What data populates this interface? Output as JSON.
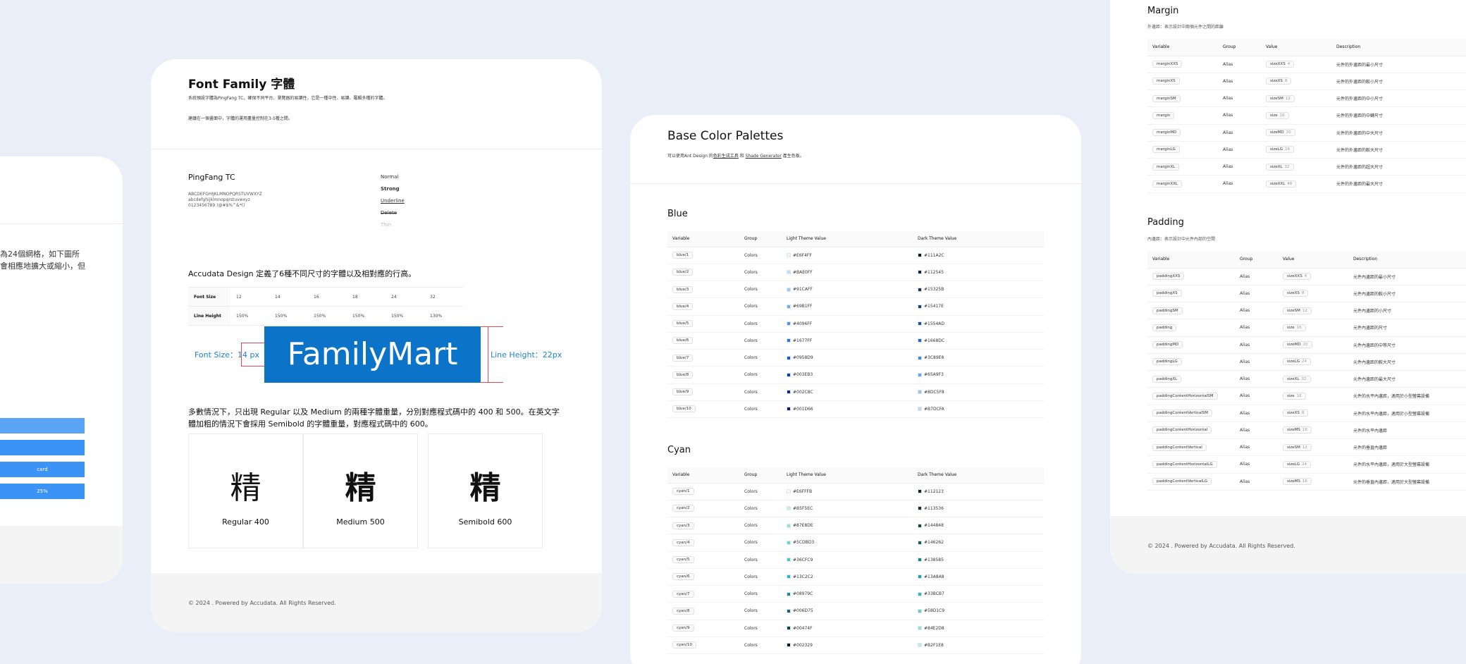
{
  "card1": {
    "text_lines": [
      "為24個網格，如下圖所",
      "會相應地擴大或縮小，但"
    ],
    "bars": [
      "",
      "",
      "card",
      "25%"
    ]
  },
  "fontfamily": {
    "title": "Font Family 字體",
    "desc1": "系統預設字體為PingFang TC，確保不同平台、瀏覽器的易讀性，它是一種中性、易讀、羅輯多種的字體。",
    "desc2": "建議在一個畫面中，字體的運用盡量控制在3-5種之間。",
    "font_name": "PingFang TC",
    "alphabet": [
      "ABCDEFGHIJKLMNOPQRSTUVWXYZ",
      "abcdefghijklmnopqrstuvwxyz",
      "0123456789 !@#$%^&*()"
    ],
    "styles": [
      "Normal",
      "Strong",
      "Underline",
      "Delete",
      "Thin"
    ],
    "sizes_heading": "Accudata Design 定義了6種不同尺寸的字體以及相對應的行高。",
    "size_row_label": "Font Size",
    "sizes": [
      "12",
      "14",
      "16",
      "18",
      "24",
      "32"
    ],
    "lh_row_label": "Line Height",
    "line_heights": [
      "150%",
      "150%",
      "150%",
      "150%",
      "150%",
      "130%"
    ],
    "demo_word": "FamilyMart",
    "demo_font_size_label": "Font Size：14 px",
    "demo_line_height_label": "Line Height：22px",
    "weights_text": "多數情況下，只出現 Regular 以及 Medium 的兩種字體重量，分別對應程式碼中的 400 和 500。在英文字體加粗的情況下會採用 Semibold 的字體重量，對應程式碼中的 600。",
    "weight_glyph": "精",
    "weights": [
      "Regular 400",
      "Medium 500",
      "Semibold 600"
    ],
    "footer": "© 2024 . Powered by Accudata. All Rights Reserved."
  },
  "palettes": {
    "title": "Base Color Palettes",
    "desc_prefix": "可以使用Ant Design 的",
    "link1": "色彩生成工具",
    "desc_mid": " 和 ",
    "link2": "Shade Generator",
    "desc_suffix": " 產生色板。",
    "headers": [
      "Variable",
      "Group",
      "Light Theme Value",
      "Dark Theme Value"
    ],
    "blue_title": "Blue",
    "blue": [
      {
        "var": "blue/1",
        "group": "Colors",
        "light": "#E6F4FF",
        "dark": "#111A2C"
      },
      {
        "var": "blue/2",
        "group": "Colors",
        "light": "#BAE0FF",
        "dark": "#112545"
      },
      {
        "var": "blue/3",
        "group": "Colors",
        "light": "#91CAFF",
        "dark": "#15325B"
      },
      {
        "var": "blue/4",
        "group": "Colors",
        "light": "#69B1FF",
        "dark": "#15417E"
      },
      {
        "var": "blue/5",
        "group": "Colors",
        "light": "#4096FF",
        "dark": "#1554AD"
      },
      {
        "var": "blue/6",
        "group": "Colors",
        "light": "#1677FF",
        "dark": "#1668DC"
      },
      {
        "var": "blue/7",
        "group": "Colors",
        "light": "#0958D9",
        "dark": "#3C89E8"
      },
      {
        "var": "blue/8",
        "group": "Colors",
        "light": "#003EB3",
        "dark": "#65A9F3"
      },
      {
        "var": "blue/9",
        "group": "Colors",
        "light": "#002C8C",
        "dark": "#8DC5F8"
      },
      {
        "var": "blue/10",
        "group": "Colors",
        "light": "#001D66",
        "dark": "#B7DCFA"
      }
    ],
    "cyan_title": "Cyan",
    "cyan": [
      {
        "var": "cyan/1",
        "group": "Colors",
        "light": "#E6FFFB",
        "dark": "#112123"
      },
      {
        "var": "cyan/2",
        "group": "Colors",
        "light": "#B5F5EC",
        "dark": "#113536"
      },
      {
        "var": "cyan/3",
        "group": "Colors",
        "light": "#87E8DE",
        "dark": "#144848"
      },
      {
        "var": "cyan/4",
        "group": "Colors",
        "light": "#5CDBD3",
        "dark": "#146262"
      },
      {
        "var": "cyan/5",
        "group": "Colors",
        "light": "#36CFC9",
        "dark": "#138585"
      },
      {
        "var": "cyan/6",
        "group": "Colors",
        "light": "#13C2C2",
        "dark": "#13A8A8"
      },
      {
        "var": "cyan/7",
        "group": "Colors",
        "light": "#08979C",
        "dark": "#33BCB7"
      },
      {
        "var": "cyan/8",
        "group": "Colors",
        "light": "#006D75",
        "dark": "#58D1C9"
      },
      {
        "var": "cyan/9",
        "group": "Colors",
        "light": "#00474F",
        "dark": "#84E2D8"
      },
      {
        "var": "cyan/10",
        "group": "Colors",
        "light": "#002329",
        "dark": "#B2F1E8"
      }
    ]
  },
  "spacing": {
    "margin_title": "Margin",
    "margin_desc": "外邊距：表示設計中兩個元件之間的距離",
    "headers": [
      "Variable",
      "Group",
      "Value",
      "Description"
    ],
    "margin": [
      {
        "var": "marginXXS",
        "group": "Alias",
        "val": "sizeXXS",
        "num": "4",
        "desc": "元件的外邊距的最小尺寸"
      },
      {
        "var": "marginXS",
        "group": "Alias",
        "val": "sizeXS",
        "num": "8",
        "desc": "元件的外邊距的較小尺寸"
      },
      {
        "var": "marginSM",
        "group": "Alias",
        "val": "sizeSM",
        "num": "12",
        "desc": "元件的外邊距的中小尺寸"
      },
      {
        "var": "margin",
        "group": "Alias",
        "val": "size",
        "num": "16",
        "desc": "元件的外邊距的中轉尺寸"
      },
      {
        "var": "marginMD",
        "group": "Alias",
        "val": "sizeMD",
        "num": "20",
        "desc": "元件的外邊距的中大尺寸"
      },
      {
        "var": "marginLG",
        "group": "Alias",
        "val": "sizeLG",
        "num": "24",
        "desc": "元件的外邊距的較大尺寸"
      },
      {
        "var": "marginXL",
        "group": "Alias",
        "val": "sizeXL",
        "num": "32",
        "desc": "元件的外邊距的超大尺寸"
      },
      {
        "var": "marginXXL",
        "group": "Alias",
        "val": "sizeXXL",
        "num": "48",
        "desc": "元件的外邊距的最大尺寸"
      }
    ],
    "padding_title": "Padding",
    "padding_desc": "內邊距：表示設計中元件內部的空間",
    "padding": [
      {
        "var": "paddingXXS",
        "group": "Alias",
        "val": "sizeXXS",
        "num": "4",
        "desc": "元件內邊距的最小尺寸"
      },
      {
        "var": "paddingXS",
        "group": "Alias",
        "val": "sizeXS",
        "num": "8",
        "desc": "元件內邊距的較小尺寸"
      },
      {
        "var": "paddingSM",
        "group": "Alias",
        "val": "sizeSM",
        "num": "12",
        "desc": "元件內邊距的小尺寸"
      },
      {
        "var": "padding",
        "group": "Alias",
        "val": "size",
        "num": "16",
        "desc": "元件內邊距的尺寸"
      },
      {
        "var": "paddingMD",
        "group": "Alias",
        "val": "sizeMD",
        "num": "20",
        "desc": "元件內邊距的中等尺寸"
      },
      {
        "var": "paddingLG",
        "group": "Alias",
        "val": "sizeLG",
        "num": "24",
        "desc": "元件內邊距的較大尺寸"
      },
      {
        "var": "paddingXL",
        "group": "Alias",
        "val": "sizeXL",
        "num": "32",
        "desc": "元件內邊距的最大尺寸"
      },
      {
        "var": "paddingContentHorizontalSM",
        "group": "Alias",
        "val": "size",
        "num": "16",
        "desc": "元件的水平內邊距，適用於小型螢幕設備"
      },
      {
        "var": "paddingContentVerticalSM",
        "group": "Alias",
        "val": "sizeXS",
        "num": "8",
        "desc": "元件的水平內邊距，適用於小型螢幕設備"
      },
      {
        "var": "paddingContentHorizontal",
        "group": "Alias",
        "val": "sizeMS",
        "num": "16",
        "desc": "元件的水平內邊距"
      },
      {
        "var": "paddingContentVertical",
        "group": "Alias",
        "val": "sizeSM",
        "num": "12",
        "desc": "元件的垂直內邊距"
      },
      {
        "var": "paddingContentHorizontalLG",
        "group": "Alias",
        "val": "sizeLG",
        "num": "24",
        "desc": "元件的水平內邊距，適用於大型螢幕設備"
      },
      {
        "var": "paddingContentVerticalLG",
        "group": "Alias",
        "val": "sizeMS",
        "num": "16",
        "desc": "元件的垂直內邊距，適用於大型螢幕設備"
      }
    ],
    "footer": "© 2024 . Powered by Accudata. All Rights Reserved."
  }
}
